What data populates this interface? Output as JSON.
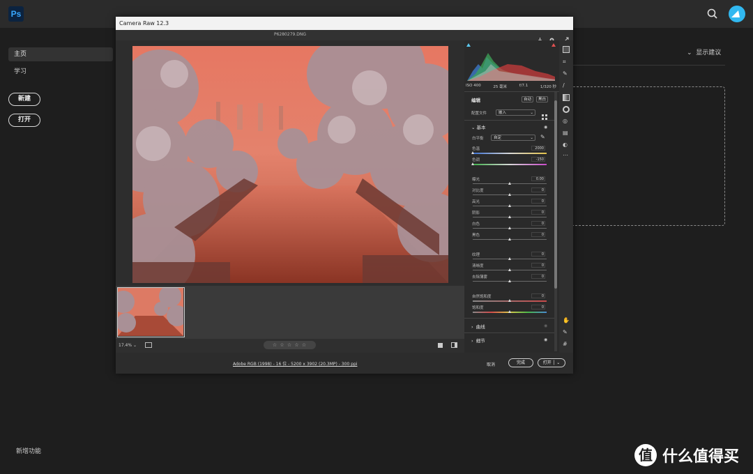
{
  "app": {
    "logo": "Ps",
    "sidebar": {
      "home": "主页",
      "learn": "学习"
    },
    "buttons": {
      "new": "新建",
      "open": "打开"
    },
    "whats_new": "新增功能",
    "suggestions": "显示建议",
    "watermark": {
      "symbol": "值",
      "text": "什么值得买"
    }
  },
  "dialog": {
    "title": "Camera Raw 12.3",
    "filename": "P6280279.DNG",
    "zoom": "17.4%",
    "rating": "☆ ☆ ☆ ☆ ☆",
    "footer_link": "Adobe RGB (1998) - 16 位 - 5200 x 3902 (20.3MP) - 300 ppi",
    "cancel": "取消",
    "done": "完成",
    "open": "打开",
    "exif": [
      "ISO 400",
      "25 毫米",
      "f/7.1",
      "1/320 秒"
    ],
    "edit": {
      "title": "编辑",
      "auto": "自动",
      "bw": "黑白"
    },
    "profile": {
      "label": "配置文件",
      "value": "嵌入"
    },
    "basic": {
      "title": "基本",
      "wb_label": "白平衡",
      "wb_value": "自定",
      "sliders": [
        {
          "label": "色温",
          "value": "2000",
          "pos": 0
        },
        {
          "label": "色调",
          "value": "-150",
          "pos": 0
        },
        {
          "label": "曝光",
          "value": "0.00",
          "pos": 0.5
        },
        {
          "label": "对比度",
          "value": "0",
          "pos": 0.5
        },
        {
          "label": "高光",
          "value": "0",
          "pos": 0.5
        },
        {
          "label": "阴影",
          "value": "0",
          "pos": 0.5
        },
        {
          "label": "白色",
          "value": "0",
          "pos": 0.5
        },
        {
          "label": "黑色",
          "value": "0",
          "pos": 0.5
        },
        {
          "label": "纹理",
          "value": "0",
          "pos": 0.5
        },
        {
          "label": "清晰度",
          "value": "0",
          "pos": 0.5
        },
        {
          "label": "去除薄雾",
          "value": "0",
          "pos": 0.5
        },
        {
          "label": "自然饱和度",
          "value": "0",
          "pos": 0.5
        },
        {
          "label": "饱和度",
          "value": "0",
          "pos": 0.5
        }
      ]
    },
    "sections": {
      "curve": "曲线",
      "detail": "细节"
    }
  }
}
